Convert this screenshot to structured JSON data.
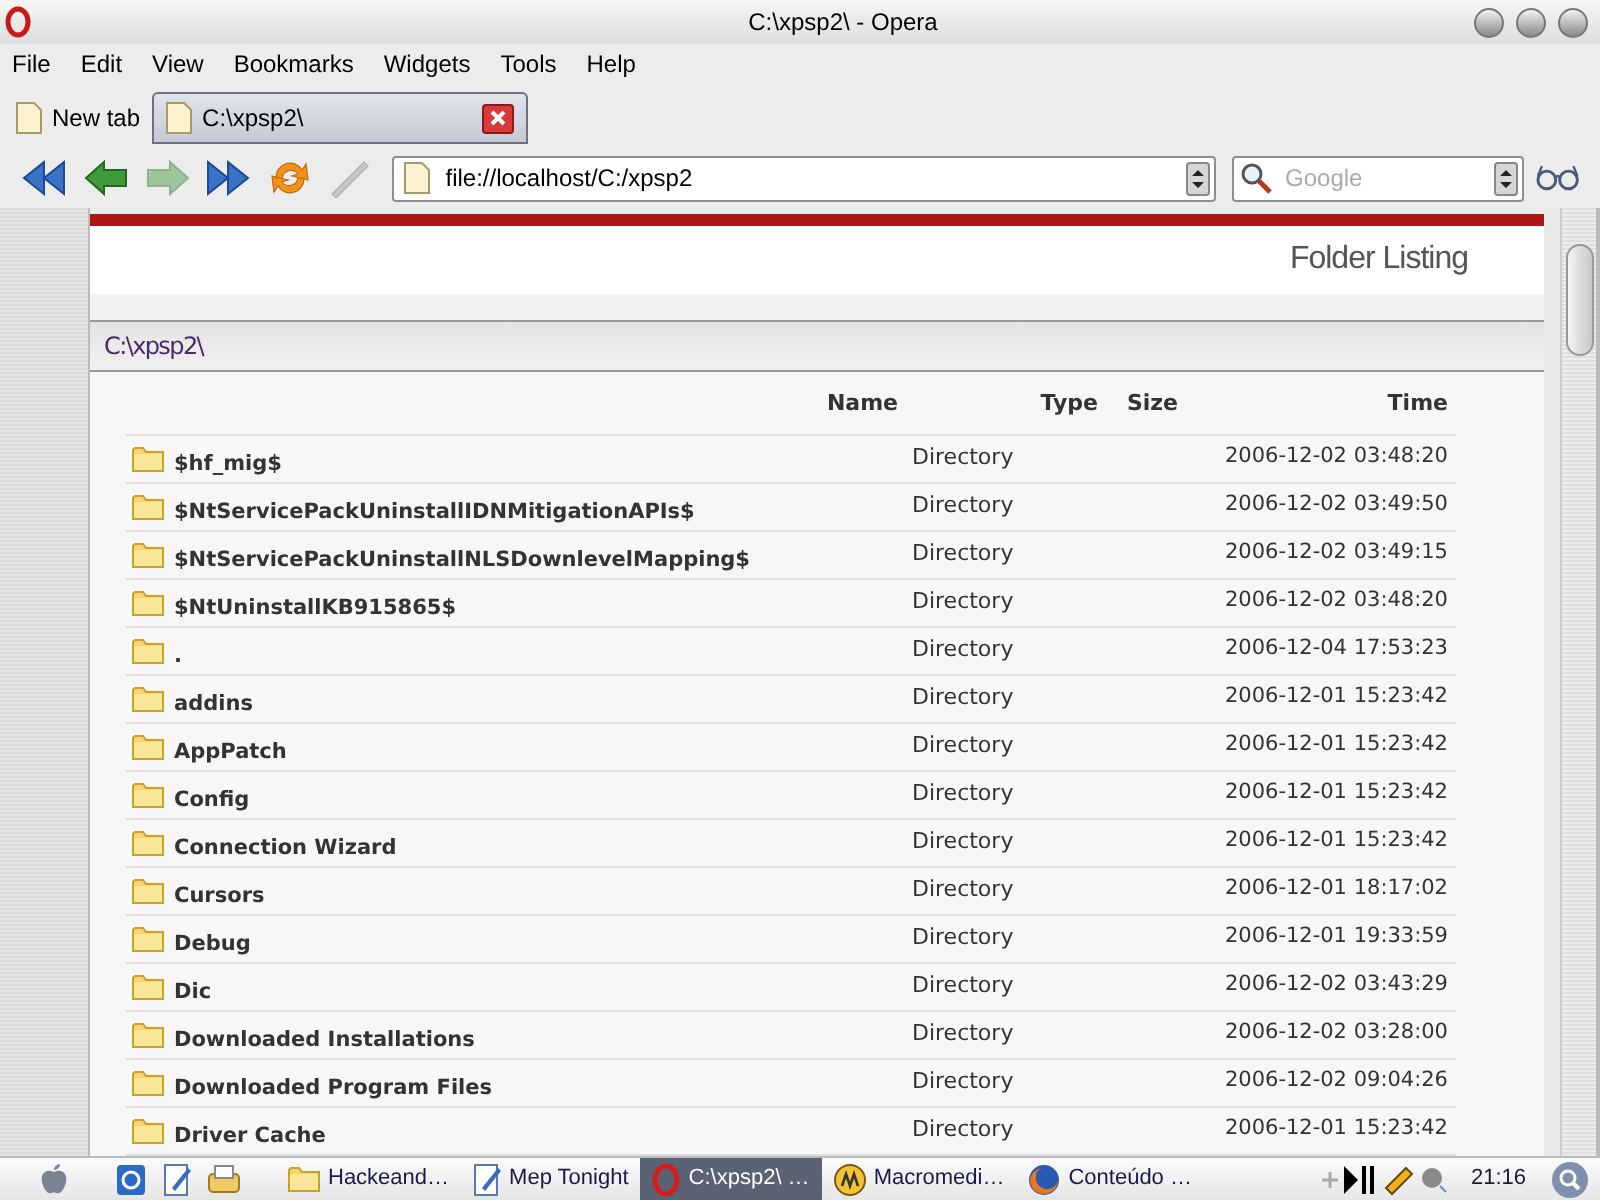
{
  "window": {
    "title": "C:\\xpsp2\\ - Opera"
  },
  "menu": [
    "File",
    "Edit",
    "View",
    "Bookmarks",
    "Widgets",
    "Tools",
    "Help"
  ],
  "new_tab_button": {
    "label": "New tab"
  },
  "tabs": [
    {
      "label": "C:\\xpsp2\\",
      "selected": true
    }
  ],
  "toolbar": {
    "buttons": [
      {
        "kind": "rewind",
        "disabled": false
      },
      {
        "kind": "back",
        "disabled": false
      },
      {
        "kind": "forward",
        "disabled": true
      },
      {
        "kind": "fast_forward",
        "disabled": false
      },
      {
        "kind": "reload",
        "disabled": false
      },
      {
        "kind": "edit",
        "disabled": true
      }
    ]
  },
  "address": {
    "value": "file://localhost/C:/xpsp2"
  },
  "search": {
    "placeholder": "Google"
  },
  "page": {
    "heading": "Folder Listing",
    "path": "C:\\xpsp2\\",
    "columns": [
      "Name",
      "Type",
      "Size",
      "Time"
    ],
    "rows": [
      {
        "name": "$hf_mig$",
        "type": "Directory",
        "time": "2006-12-02 03:48:20"
      },
      {
        "name": "$NtServicePackUninstallIDNMitigationAPIs$",
        "type": "Directory",
        "time": "2006-12-02 03:49:50"
      },
      {
        "name": "$NtServicePackUninstallNLSDownlevelMapping$",
        "type": "Directory",
        "time": "2006-12-02 03:49:15"
      },
      {
        "name": "$NtUninstallKB915865$",
        "type": "Directory",
        "time": "2006-12-02 03:48:20"
      },
      {
        "name": ".",
        "type": "Directory",
        "time": "2006-12-04 17:53:23"
      },
      {
        "name": "addins",
        "type": "Directory",
        "time": "2006-12-01 15:23:42"
      },
      {
        "name": "AppPatch",
        "type": "Directory",
        "time": "2006-12-01 15:23:42"
      },
      {
        "name": "Config",
        "type": "Directory",
        "time": "2006-12-01 15:23:42"
      },
      {
        "name": "Connection Wizard",
        "type": "Directory",
        "time": "2006-12-01 15:23:42"
      },
      {
        "name": "Cursors",
        "type": "Directory",
        "time": "2006-12-01 18:17:02"
      },
      {
        "name": "Debug",
        "type": "Directory",
        "time": "2006-12-01 19:33:59"
      },
      {
        "name": "Dic",
        "type": "Directory",
        "time": "2006-12-02 03:43:29"
      },
      {
        "name": "Downloaded Installations",
        "type": "Directory",
        "time": "2006-12-02 03:28:00"
      },
      {
        "name": "Downloaded Program Files",
        "type": "Directory",
        "time": "2006-12-02 09:04:26"
      },
      {
        "name": "Driver Cache",
        "type": "Directory",
        "time": "2006-12-01 15:23:42"
      }
    ]
  },
  "taskbar": {
    "items": [
      {
        "label": "Hackeand…",
        "kind": "folder",
        "selected": false
      },
      {
        "label": "Mep Tonight",
        "kind": "notepad",
        "selected": false
      },
      {
        "label": "C:\\xpsp2\\ …",
        "kind": "opera",
        "selected": true
      },
      {
        "label": "Macromedi…",
        "kind": "macromedia",
        "selected": false
      },
      {
        "label": "Conteúdo …",
        "kind": "firefox",
        "selected": false
      }
    ],
    "clock": "21:16"
  }
}
